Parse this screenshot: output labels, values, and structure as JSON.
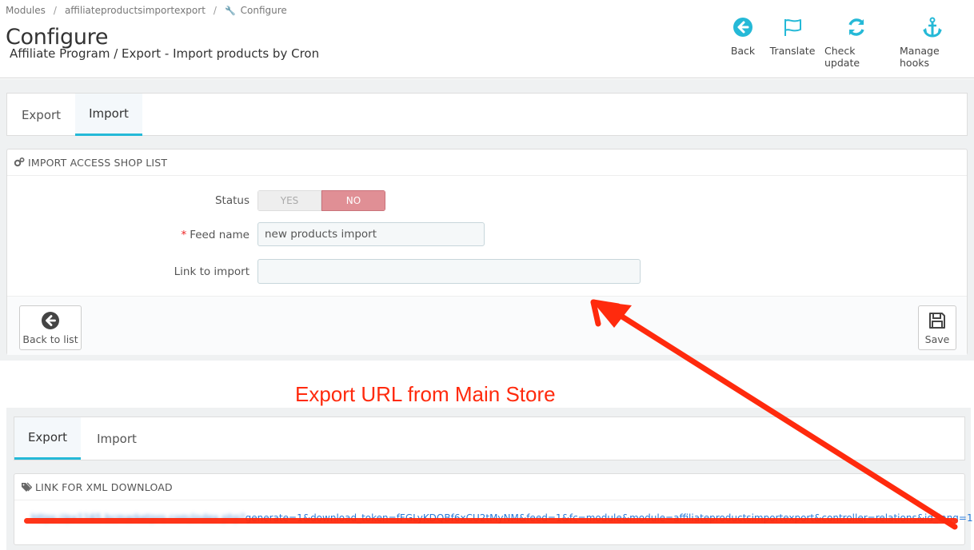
{
  "breadcrumb": {
    "items": [
      "Modules",
      "affiliateproductsimportexport",
      "Configure"
    ],
    "separator": "/"
  },
  "header": {
    "title": "Configure",
    "subtitle": "Affiliate Program / Export - Import products by Cron"
  },
  "toolbar": {
    "back": "Back",
    "translate": "Translate",
    "check_update": "Check update",
    "manage_hooks": "Manage hooks"
  },
  "tabs_top": {
    "export": "Export",
    "import": "Import",
    "active": "Import"
  },
  "import_panel": {
    "heading": "IMPORT ACCESS SHOP LIST",
    "status_label": "Status",
    "status_yes": "YES",
    "status_no": "NO",
    "status_value": "NO",
    "feed_name_required": "*",
    "feed_name_label": "Feed name",
    "feed_name_value": "new products import",
    "link_label": "Link to import",
    "link_value": "",
    "back_button": "Back to list",
    "save_button": "Save"
  },
  "annotation": {
    "text": "Export URL from Main Store",
    "color": "#ff2a0d"
  },
  "tabs_bottom": {
    "export": "Export",
    "import": "Import",
    "active": "Export"
  },
  "xml_panel": {
    "heading": "LINK FOR XML DOWNLOAD",
    "link_hidden_part": "https://px1165.bcmarketpro.com/index.php?",
    "link_visible_part": "generate=1&download_token=fFGLyKDQBf6xCU2tMyNM&feed=1&fc=module&module=affiliateproductsimportexport&controller=relations&id_lang=1"
  },
  "colors": {
    "accent": "#25b9d7",
    "toggle_no": "#e08f95",
    "link": "#2a7bd9",
    "annotation_red": "#ff2a0d"
  }
}
